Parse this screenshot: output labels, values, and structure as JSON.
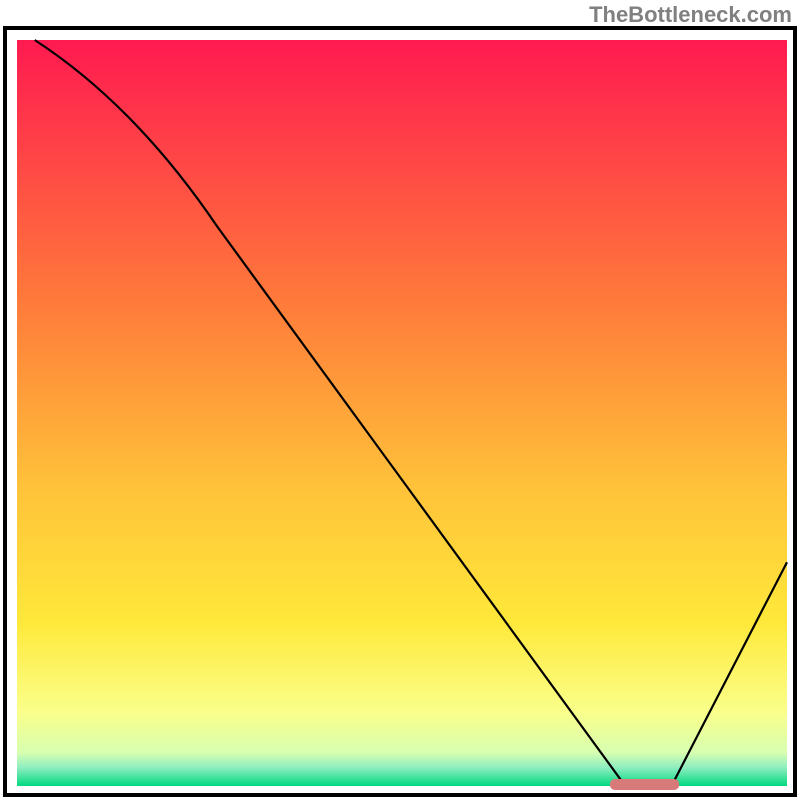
{
  "watermark": "TheBottleneck.com",
  "chart_data": {
    "type": "line",
    "title": "",
    "xlabel": "",
    "ylabel": "",
    "xlim": [
      0,
      100
    ],
    "ylim": [
      0,
      100
    ],
    "x": [
      2.3,
      26,
      79,
      85,
      100
    ],
    "values": [
      100,
      75,
      0,
      0,
      30
    ],
    "marker": {
      "x_start": 77,
      "x_end": 86,
      "y": 0.2,
      "color": "#d97a7a"
    },
    "gradient_stops": [
      {
        "offset": 0.0,
        "color": "#ff1a50"
      },
      {
        "offset": 0.35,
        "color": "#ff7a3a"
      },
      {
        "offset": 0.6,
        "color": "#ffc23a"
      },
      {
        "offset": 0.78,
        "color": "#ffe83a"
      },
      {
        "offset": 0.9,
        "color": "#faff8a"
      },
      {
        "offset": 0.955,
        "color": "#d8ffb0"
      },
      {
        "offset": 0.975,
        "color": "#90eec0"
      },
      {
        "offset": 1.0,
        "color": "#00d980"
      }
    ],
    "curve_color": "#000000",
    "border_color": "#000000"
  },
  "plot": {
    "outer_left": 5,
    "outer_top": 28,
    "outer_width": 790,
    "outer_height": 767,
    "inner_left": 17,
    "inner_top": 40,
    "inner_width": 770,
    "inner_height": 746
  }
}
